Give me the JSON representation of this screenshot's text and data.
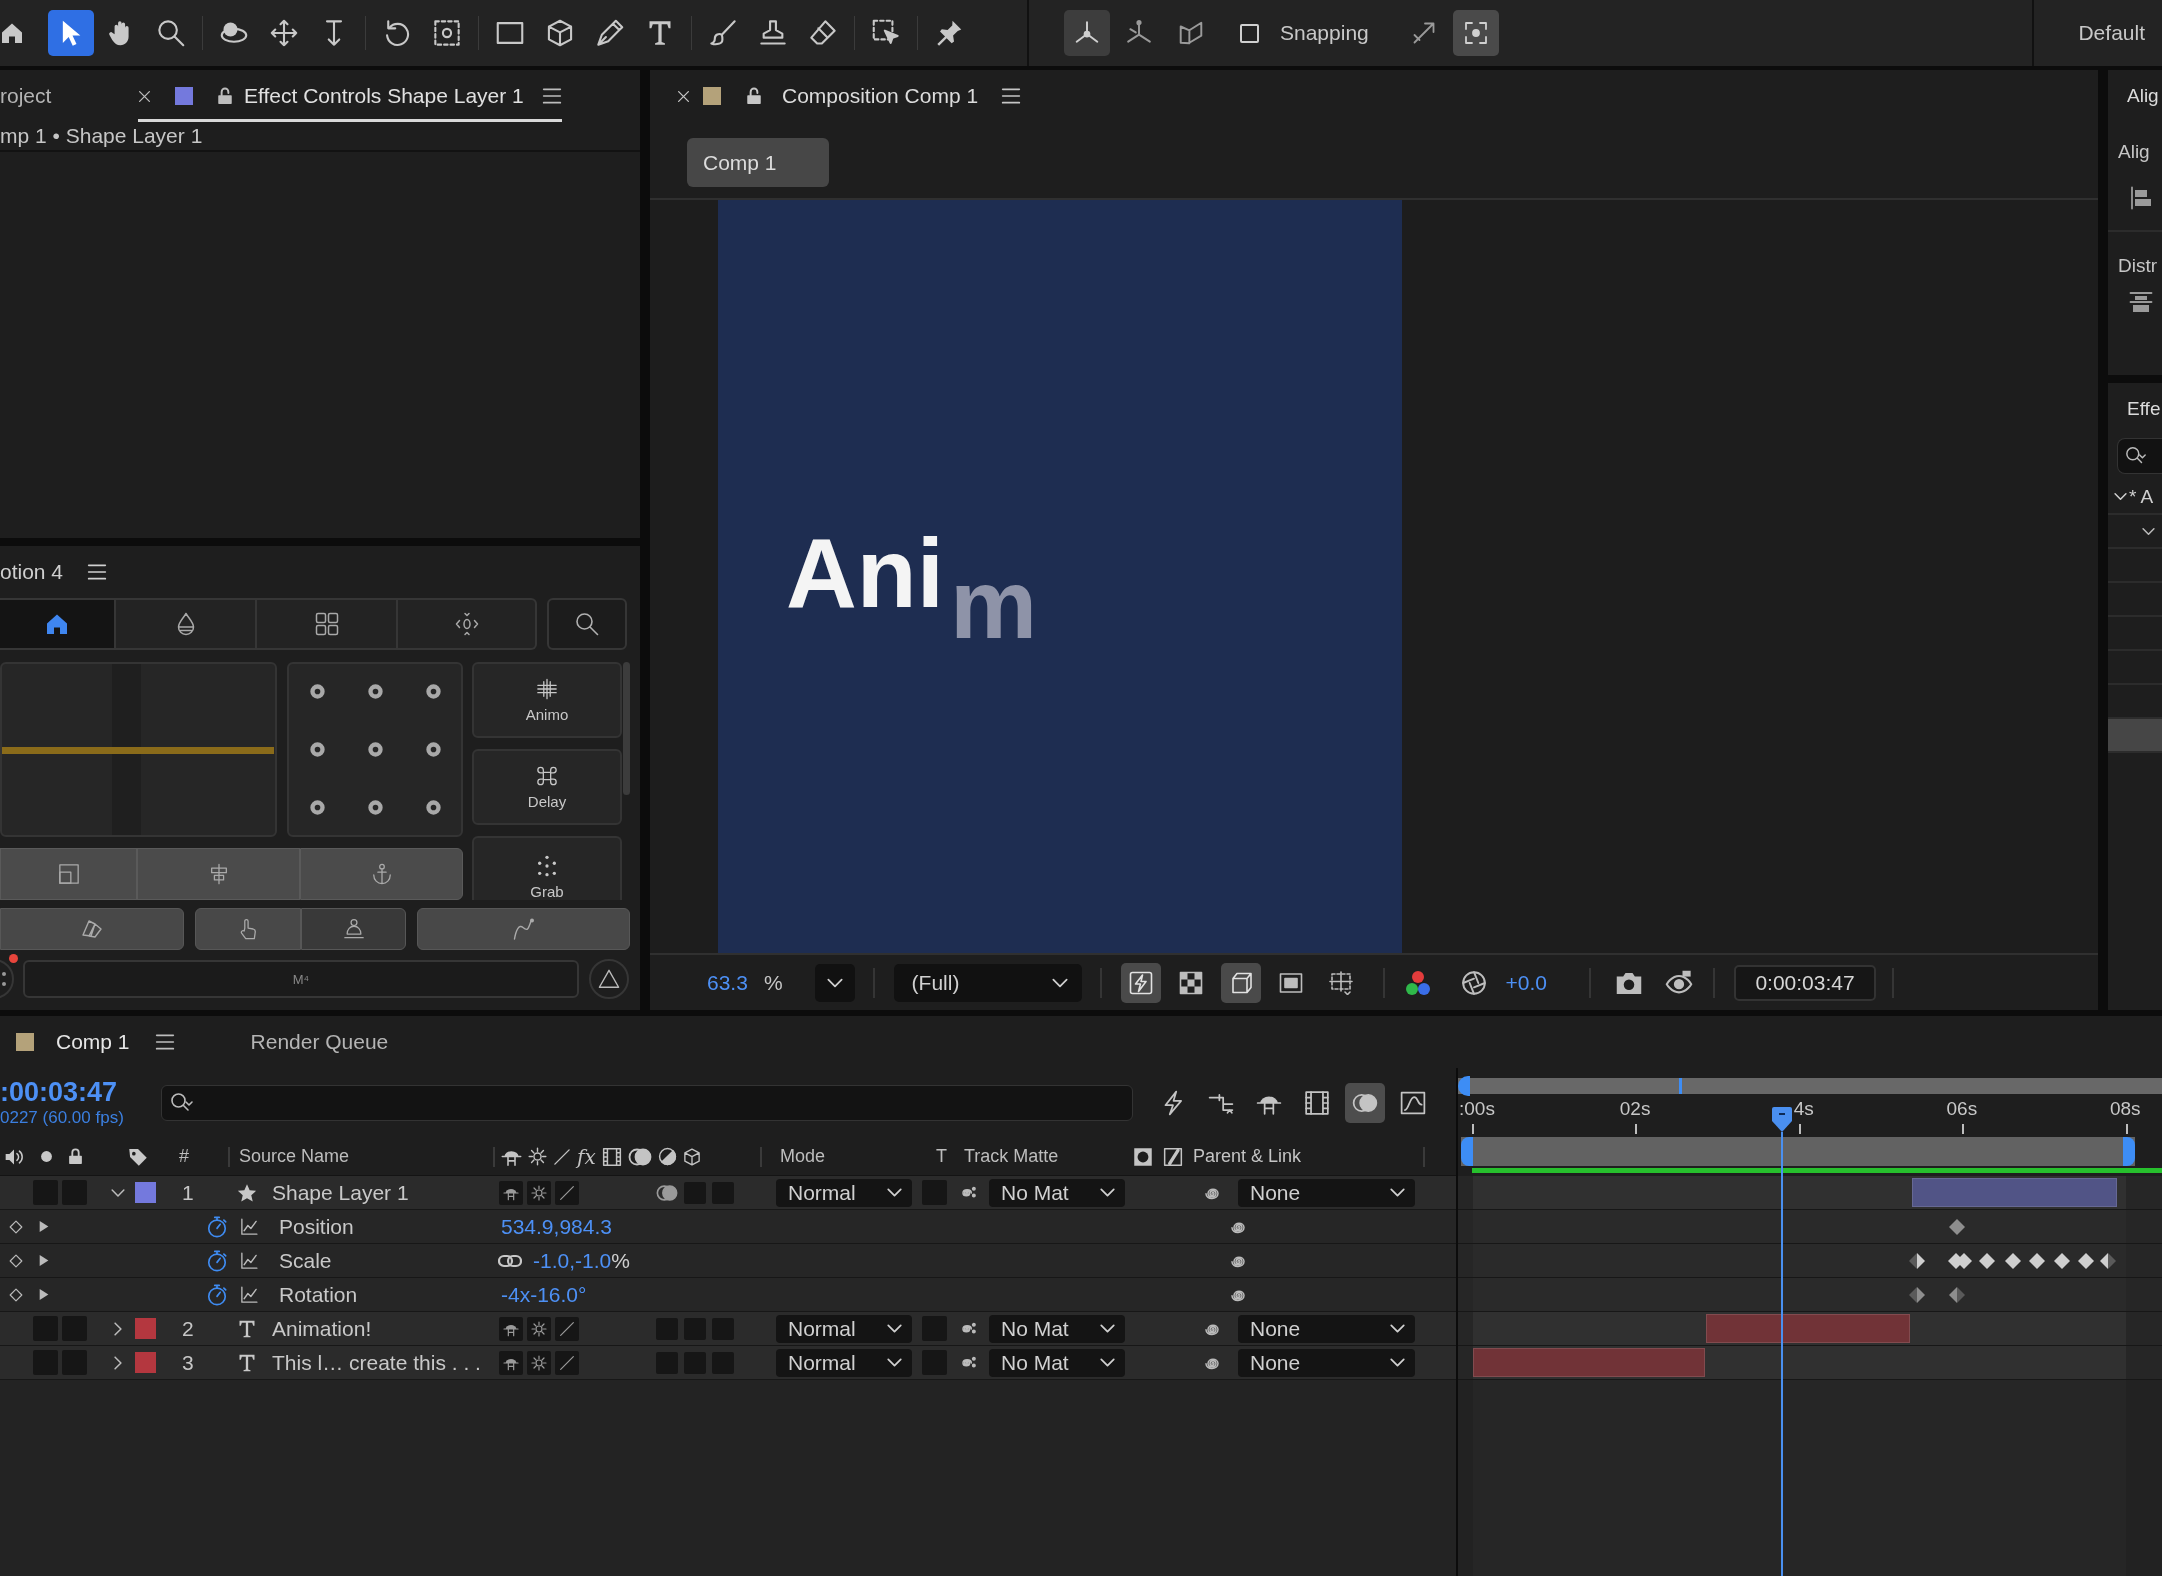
{
  "toolbar": {
    "tools": [
      {
        "selected": false
      },
      {
        "selected": true
      },
      {
        "selected": false
      },
      {
        "selected": false
      },
      {
        "selected": false
      },
      {
        "selected": false
      },
      {
        "selected": false
      },
      {
        "selected": false
      },
      {
        "selected": false
      },
      {
        "selected": false
      },
      {
        "selected": false
      },
      {
        "selected": false
      },
      {
        "selected": false
      },
      {
        "selected": false
      },
      {
        "selected": false
      },
      {
        "selected": false
      },
      {
        "selected": false
      },
      {
        "selected": false
      }
    ],
    "axis_modes": [
      {
        "selected": true
      },
      {
        "selected": false
      },
      {
        "selected": false
      }
    ],
    "snapping": {
      "label": "Snapping",
      "checked": false
    },
    "snap_options": [
      {
        "selected": false
      },
      {
        "selected": true
      }
    ],
    "workspace": "Default"
  },
  "effect_controls": {
    "tabs": [
      {
        "label": "roject",
        "selected": false
      },
      {
        "label": "Effect Controls Shape Layer 1",
        "selected": true,
        "color": "#7479dd",
        "locked": false
      }
    ],
    "breadcrumb": "mp 1 • Shape Layer 1"
  },
  "motion": {
    "title": "otion 4",
    "tabs": [
      {
        "selected": true
      },
      {
        "selected": false
      },
      {
        "selected": false
      },
      {
        "selected": false
      }
    ],
    "presets": [
      {
        "label": "Animo"
      },
      {
        "label": "Delay"
      },
      {
        "label": "Grab"
      }
    ],
    "command": {
      "placeholder": "M⁴"
    },
    "alert": true
  },
  "composition": {
    "tab": {
      "label": "Composition Comp 1",
      "color": "#b4a27a",
      "locked": false
    },
    "breadcrumb": "Comp 1",
    "canvas": {
      "texts": [
        {
          "text": "Ani",
          "kind": "settled"
        },
        {
          "text": "m",
          "kind": "entering"
        }
      ]
    },
    "footer": {
      "zoom": "63.3",
      "zoom_unit": "%",
      "resolution": "(Full)",
      "toggles": [
        {
          "selected": true
        },
        {
          "selected": false
        },
        {
          "selected": true
        },
        {
          "selected": false
        },
        {
          "selected": false
        }
      ],
      "exposure": "+0.0",
      "timecode": "0:00:03:47"
    }
  },
  "side_panels": {
    "align": {
      "tab": "Alig",
      "heading": "Alig",
      "distribute": "Distr"
    },
    "effects": {
      "tab": "Effe",
      "tree": [
        {
          "label": "* A",
          "expanded": true,
          "children": [
            {
              "expanded": true
            }
          ]
        }
      ],
      "rows": [
        {
          "selected": false
        },
        {
          "selected": false
        },
        {
          "selected": false
        },
        {
          "selected": false
        },
        {
          "selected": false
        },
        {
          "selected": true
        }
      ]
    }
  },
  "timeline": {
    "tabs": [
      {
        "label": "Comp 1",
        "selected": true,
        "color": "#b4a27a"
      },
      {
        "label": "Render Queue",
        "selected": false
      }
    ],
    "timecode": ":00:03:47",
    "frame_info": "0227 (60.00 fps)",
    "toggles": [
      {
        "selected": false
      },
      {
        "selected": false
      },
      {
        "selected": false
      },
      {
        "selected": false
      },
      {
        "selected": true
      },
      {
        "selected": false
      }
    ],
    "columns": {
      "number": "#",
      "source_name": "Source Name",
      "fx": "fx",
      "mode": "Mode",
      "t": "T",
      "track_matte": "Track Matte",
      "parent": "Parent & Link"
    },
    "layers": [
      {
        "number": "1",
        "name": "Shape Layer 1",
        "kind": "shape",
        "color": "#7479dd",
        "expanded": true,
        "motion_blur": true,
        "mode": "Normal",
        "track_matte": "No Mat",
        "parent": "None",
        "properties": [
          {
            "name": "Position",
            "value": "534.9,984.3",
            "linked": false,
            "keyframes": [
              {
                "kind": "full",
                "selected": false
              }
            ]
          },
          {
            "name": "Scale",
            "value": "-1.0,-1.0",
            "unit": "%",
            "linked": true,
            "keyframes": [
              {
                "kind": "start",
                "selected": true
              },
              {
                "kind": "double",
                "selected": true
              },
              {
                "kind": "full",
                "selected": true
              },
              {
                "kind": "full",
                "selected": true
              },
              {
                "kind": "full",
                "selected": true
              },
              {
                "kind": "full",
                "selected": true
              },
              {
                "kind": "full",
                "selected": true
              },
              {
                "kind": "end",
                "selected": true
              }
            ]
          },
          {
            "name": "Rotation",
            "value": "-4x-16.0°",
            "linked": false,
            "keyframes": [
              {
                "kind": "start",
                "selected": false
              },
              {
                "kind": "end",
                "selected": false
              }
            ]
          }
        ]
      },
      {
        "number": "2",
        "name": "Animation!",
        "kind": "text",
        "color": "#b4373f",
        "expanded": false,
        "motion_blur": false,
        "mode": "Normal",
        "track_matte": "No Mat",
        "parent": "None"
      },
      {
        "number": "3",
        "name": "This l… create this . . .",
        "kind": "text",
        "color": "#b4373f",
        "expanded": false,
        "motion_blur": false,
        "mode": "Normal",
        "track_matte": "No Mat",
        "parent": "None"
      }
    ],
    "ruler": [
      ":00s",
      "02s",
      "4s",
      "06s",
      "08s"
    ]
  }
}
